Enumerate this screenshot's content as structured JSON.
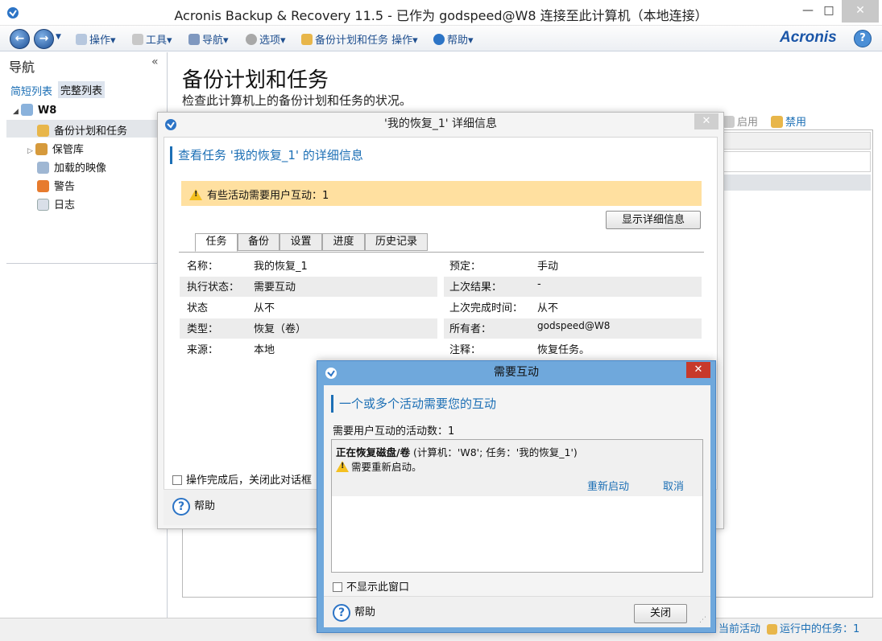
{
  "window": {
    "title": "Acronis Backup & Recovery 11.5 - 已作为 godspeed@W8 连接至此计算机（本地连接）",
    "min": "—",
    "max": "□",
    "close": "✕"
  },
  "menubar": {
    "items": [
      {
        "label": "操作▾",
        "icon": "actions-icon"
      },
      {
        "label": "工具▾",
        "icon": "tools-icon"
      },
      {
        "label": "导航▾",
        "icon": "navigate-icon"
      },
      {
        "label": "选项▾",
        "icon": "options-icon"
      },
      {
        "label": "备份计划和任务 操作▾",
        "icon": "plans-icon"
      },
      {
        "label": "帮助▾",
        "icon": "help-icon"
      }
    ],
    "brand": "Acronis",
    "help": "?"
  },
  "sidebar": {
    "heading": "导航",
    "collapse": "«",
    "short_list": "简短列表",
    "full_list": "完整列表",
    "machine": "W8",
    "items": [
      {
        "label": "备份计划和任务",
        "icon": "plans-icon"
      },
      {
        "label": "保管库",
        "icon": "vault-icon"
      },
      {
        "label": "加载的映像",
        "icon": "mounted-image-icon"
      },
      {
        "label": "警告",
        "icon": "alert-icon"
      },
      {
        "label": "日志",
        "icon": "log-icon"
      }
    ]
  },
  "main": {
    "title": "备份计划和任务",
    "subtitle": "检查此计算机上的备份计划和任务的状况。",
    "enable": "启用",
    "disable": "禁用"
  },
  "statusbar": {
    "current_activity": "当前活动",
    "running_tasks": "运行中的任务：1"
  },
  "details_dialog": {
    "title": "'我的恢复_1' 详细信息",
    "heading": "查看任务 '我的恢复_1' 的详细信息",
    "warning": "有些活动需要用户互动：1",
    "show_details": "显示详细信息",
    "tabs": [
      "任务",
      "备份",
      "设置",
      "进度",
      "历史记录"
    ],
    "left_fields": [
      {
        "k": "名称：",
        "v": "我的恢复_1"
      },
      {
        "k": "执行状态：",
        "v": "需要互动"
      },
      {
        "k": "状态",
        "v": "从不"
      },
      {
        "k": "类型：",
        "v": "恢复（卷）"
      },
      {
        "k": "来源：",
        "v": "本地"
      }
    ],
    "right_fields": [
      {
        "k": "预定：",
        "v": "手动"
      },
      {
        "k": "上次结果：",
        "v": "-"
      },
      {
        "k": "上次完成时间：",
        "v": "从不"
      },
      {
        "k": "所有者：",
        "v": "godspeed@W8"
      },
      {
        "k": "注释：",
        "v": "恢复任务。"
      }
    ],
    "close_after": "操作完成后，关闭此对话框",
    "help": "帮助"
  },
  "interaction_dialog": {
    "title": "需要互动",
    "heading": "一个或多个活动需要您的互动",
    "count_label": "需要用户互动的活动数：1",
    "activity_bold": "正在恢复磁盘/卷",
    "activity_rest": " (计算机：'W8'; 任务：'我的恢复_1')",
    "activity_message": "需要重新启动。",
    "restart": "重新启动",
    "cancel": "取消",
    "dont_show": "不显示此窗口",
    "help": "帮助",
    "close": "关闭"
  }
}
